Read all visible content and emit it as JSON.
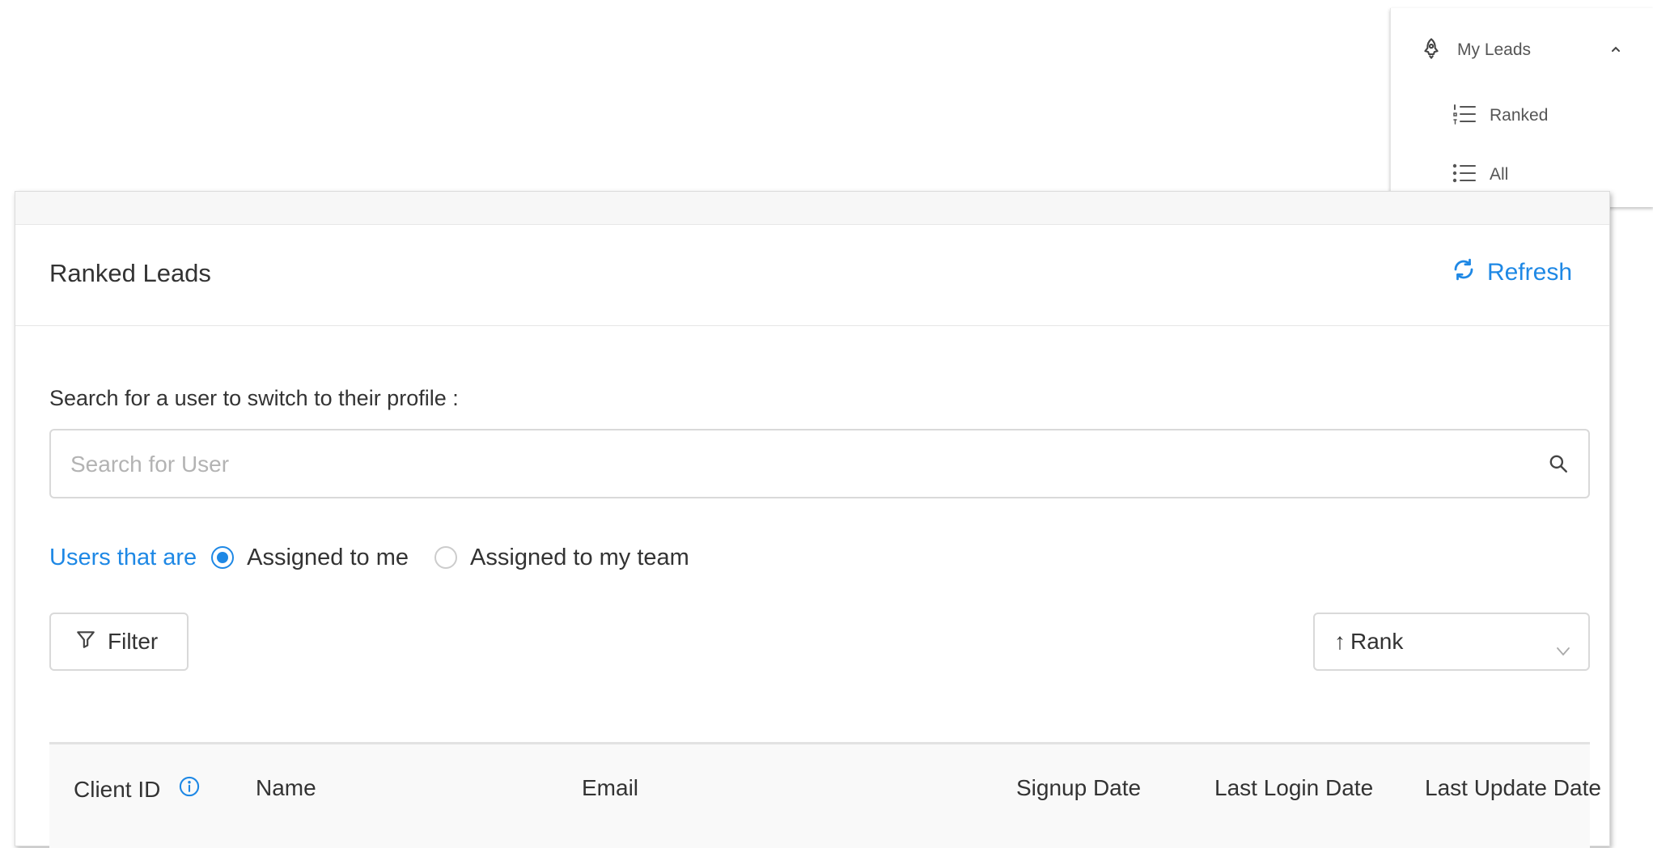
{
  "side_menu": {
    "parent_label": "My Leads",
    "parent_icon": "rocket-icon",
    "items": [
      {
        "label": "Ranked",
        "icon": "ranked-list-icon"
      },
      {
        "label": "All",
        "icon": "list-icon"
      }
    ]
  },
  "card": {
    "title": "Ranked Leads",
    "refresh_label": "Refresh"
  },
  "search": {
    "label": "Search for a user to switch to their profile :",
    "placeholder": "Search for User",
    "value": ""
  },
  "assignment_filter": {
    "prefix": "Users that are",
    "options": [
      {
        "label": "Assigned to me",
        "selected": true
      },
      {
        "label": "Assigned to my team",
        "selected": false
      }
    ]
  },
  "filter_button": {
    "label": "Filter"
  },
  "sort": {
    "arrow": "↑",
    "selected": "Rank"
  },
  "table": {
    "columns": [
      "Client ID",
      "Name",
      "Email",
      "Signup Date",
      "Last Login Date",
      "Last Update Date"
    ]
  },
  "colors": {
    "accent": "#1e88e5",
    "border": "#d9d9d9",
    "text": "#333333",
    "placeholder": "#b3b3b3"
  }
}
